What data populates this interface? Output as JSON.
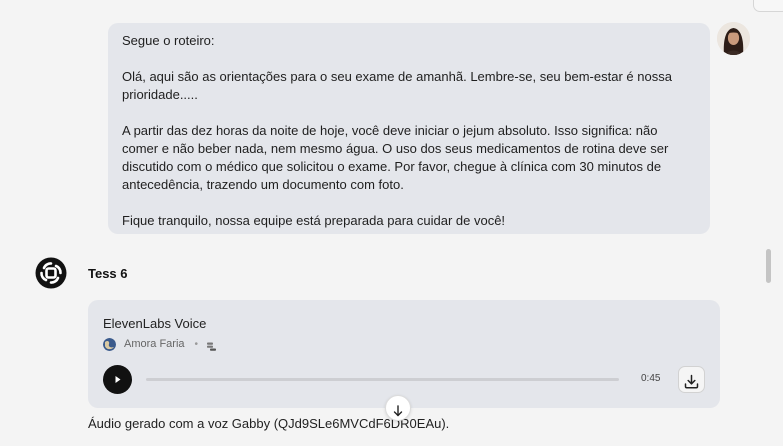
{
  "user_message": {
    "paragraphs": [
      "Segue o roteiro:",
      "Olá, aqui são as orientações para o seu exame de amanhã. Lembre-se, seu bem-estar é nossa prioridade.....",
      "A partir das dez horas da noite de hoje, você deve iniciar o jejum absoluto. Isso significa: não comer e não beber nada, nem mesmo água. O uso dos seus medicamentos de rotina deve ser discutido com o médico que solicitou o exame. Por favor, chegue à clínica com 30 minutos de antecedência, trazendo um documento com foto.",
      "Fique tranquilo, nossa equipe está preparada para cuidar de você!"
    ]
  },
  "assistant": {
    "name": "Tess 6",
    "audio": {
      "title": "ElevenLabs Voice",
      "voice_name": "Amora Faria",
      "separator": "•",
      "duration": "0:45",
      "progress": 0
    },
    "caption": "Áudio gerado com a voz Gabby (QJd9SLe6MVCdF6DR0EAu)."
  },
  "colors": {
    "page_bg": "#f4f4f4",
    "bubble_bg": "#e4e6eb",
    "accent_dark": "#111111"
  },
  "icons": {
    "play": "play-icon",
    "download": "download-icon",
    "scroll_down": "arrow-down-icon",
    "bot_logo": "tess-logo-icon",
    "voice_stack": "stack-icon"
  }
}
